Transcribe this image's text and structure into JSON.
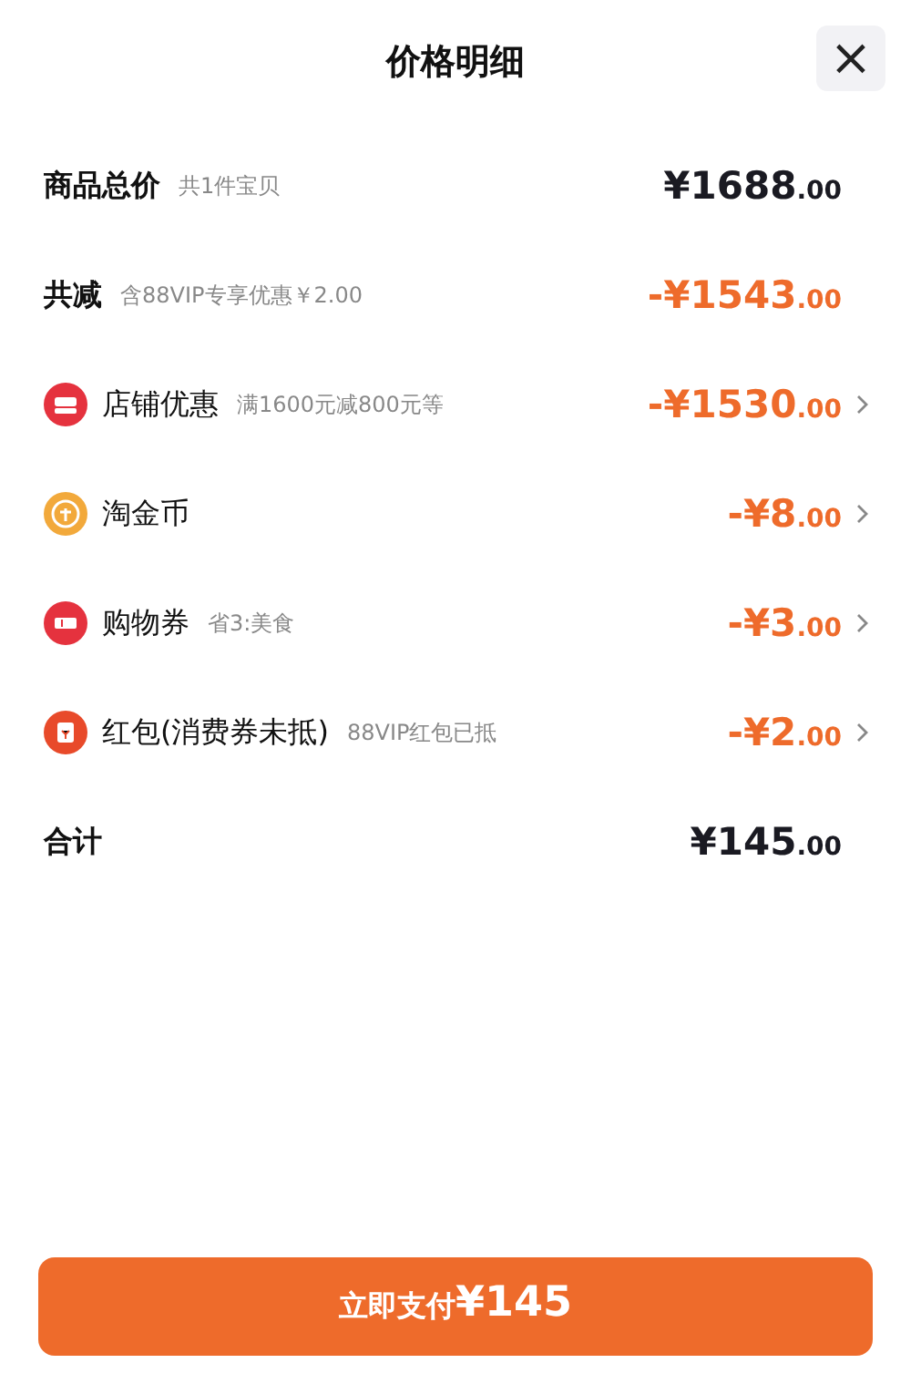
{
  "header": {
    "title": "价格明细",
    "close": "×"
  },
  "rows": [
    {
      "kind": "summary",
      "label": "商品总价",
      "note": "共1件宝贝",
      "amount": "¥1688",
      "decimals": ".00"
    },
    {
      "kind": "reduction",
      "label": "共减",
      "note": "含88VIP专享优惠￥2.00",
      "amount": "-¥1543",
      "decimals": ".00"
    },
    {
      "kind": "item",
      "label": "店铺优惠",
      "note": "满1600元减800元等",
      "amount": "-¥1530",
      "decimals": ".00"
    },
    {
      "kind": "item",
      "label": "淘金币",
      "amount": "-¥8",
      "decimals": ".00"
    },
    {
      "kind": "item",
      "label": "购物券",
      "note": "省3:美食",
      "amount": "-¥3",
      "decimals": ".00"
    },
    {
      "kind": "item",
      "label": "红包(消费券未抵)",
      "note": "88VIP红包已抵",
      "amount": "-¥2",
      "decimals": ".00"
    },
    {
      "kind": "summary",
      "label": "合计",
      "amount": "¥145",
      "decimals": ".00"
    }
  ],
  "pay_button": {
    "label": "立即支付",
    "amount": "¥145"
  }
}
